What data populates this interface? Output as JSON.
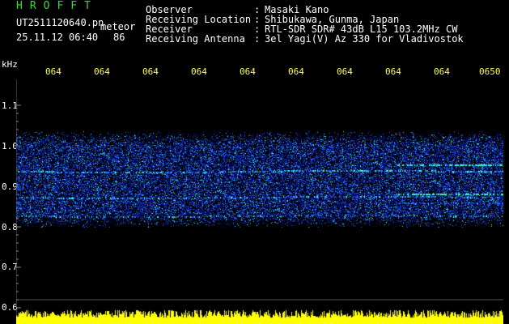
{
  "header": {
    "title": "HROFFT",
    "filename": "UT2511120640.pn",
    "meteor_label": "meteor",
    "datetime": "25.11.12 06:40",
    "count": "86",
    "info": [
      {
        "label": "Observer",
        "colon": ":",
        "value": "Masaki Kano"
      },
      {
        "label": "Receiving Location",
        "colon": ":",
        "value": "Shibukawa, Gunma, Japan"
      },
      {
        "label": "Receiver",
        "colon": ":",
        "value": "RTL-SDR SDR# 43dB L15 103.2MHz CW"
      },
      {
        "label": "Receiving Antenna",
        "colon": ":",
        "value": "3el Yagi(V) Az 330 for Vladivostok"
      }
    ]
  },
  "axis": {
    "unit": "kHz",
    "y_ticks": [
      "1.1",
      "1.0",
      "0.9",
      "0.8",
      "0.7",
      "0.6"
    ],
    "x_ticks": [
      "064",
      "064",
      "064",
      "064",
      "064",
      "064",
      "064",
      "064",
      "064",
      "0650"
    ]
  },
  "colors": {
    "title_text": "#33dd33",
    "info_text": "#ffffff",
    "x_tick_text": "#ffff33",
    "signal_low": "#0a1a9c",
    "signal_mid": "#2a6bff",
    "signal_high": "#33ffcc",
    "power_bar": "#ffff00",
    "baseline": "#00ccff"
  }
}
